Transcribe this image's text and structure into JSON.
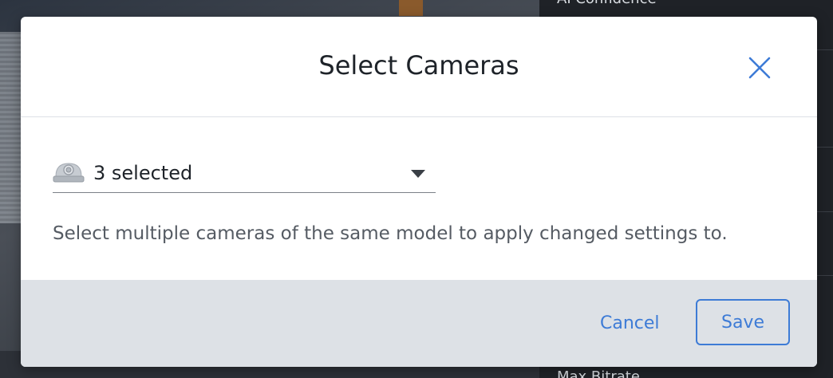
{
  "background": {
    "top_right_text": "AI Confidence",
    "bottom_right_text": "Max Bitrate"
  },
  "dialog": {
    "title": "Select Cameras",
    "close_icon": "close-icon",
    "camera_select": {
      "icon": "dome-camera-icon",
      "value": "3 selected"
    },
    "helper_text": "Select multiple cameras of the same model to apply changed settings to.",
    "cancel_label": "Cancel",
    "save_label": "Save"
  },
  "colors": {
    "accent": "#3d7bd6",
    "footer_bg": "#dde1e6",
    "title_text": "#1e2329",
    "helper_text": "#555b63"
  }
}
